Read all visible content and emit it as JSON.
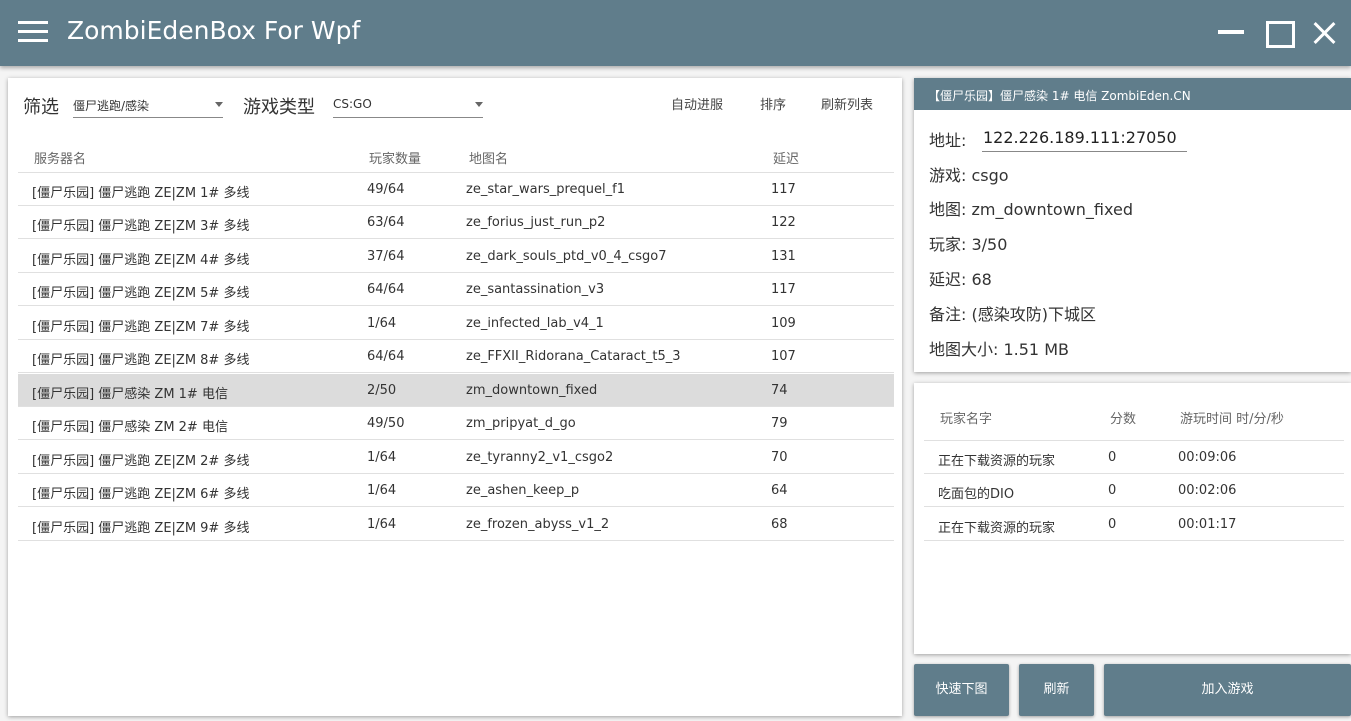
{
  "window": {
    "title": "ZombiEdenBox For Wpf"
  },
  "filters": {
    "filter_label": "筛选",
    "filter_value": "僵尸逃跑/感染",
    "game_type_label": "游戏类型",
    "game_type_value": "CS:GO",
    "auto_join_label": "自动进服",
    "sort_label": "排序",
    "refresh_list_label": "刷新列表"
  },
  "server_table": {
    "columns": [
      "服务器名",
      "玩家数量",
      "地图名",
      "延迟"
    ],
    "rows": [
      {
        "name": "[僵尸乐园] 僵尸逃跑 ZE|ZM 1# 多线",
        "players": "49/64",
        "map": "ze_star_wars_prequel_f1",
        "ping": "117"
      },
      {
        "name": "[僵尸乐园] 僵尸逃跑 ZE|ZM 3# 多线",
        "players": "63/64",
        "map": "ze_forius_just_run_p2",
        "ping": "122"
      },
      {
        "name": "[僵尸乐园] 僵尸逃跑 ZE|ZM 4# 多线",
        "players": "37/64",
        "map": "ze_dark_souls_ptd_v0_4_csgo7",
        "ping": "131"
      },
      {
        "name": "[僵尸乐园] 僵尸逃跑 ZE|ZM 5# 多线",
        "players": "64/64",
        "map": "ze_santassination_v3",
        "ping": "117"
      },
      {
        "name": "[僵尸乐园] 僵尸逃跑 ZE|ZM 7# 多线",
        "players": "1/64",
        "map": "ze_infected_lab_v4_1",
        "ping": "109"
      },
      {
        "name": "[僵尸乐园] 僵尸逃跑 ZE|ZM 8# 多线",
        "players": "64/64",
        "map": "ze_FFXII_Ridorana_Cataract_t5_3",
        "ping": "107"
      },
      {
        "name": "[僵尸乐园] 僵尸感染 ZM 1# 电信",
        "players": "2/50",
        "map": "zm_downtown_fixed",
        "ping": "74"
      },
      {
        "name": "[僵尸乐园] 僵尸感染 ZM 2# 电信",
        "players": "49/50",
        "map": "zm_pripyat_d_go",
        "ping": "79"
      },
      {
        "name": "[僵尸乐园] 僵尸逃跑 ZE|ZM 2# 多线",
        "players": "1/64",
        "map": "ze_tyranny2_v1_csgo2",
        "ping": "70"
      },
      {
        "name": "[僵尸乐园] 僵尸逃跑 ZE|ZM 6# 多线",
        "players": "1/64",
        "map": "ze_ashen_keep_p",
        "ping": "64"
      },
      {
        "name": "[僵尸乐园] 僵尸逃跑 ZE|ZM 9# 多线",
        "players": "1/64",
        "map": "ze_frozen_abyss_v1_2",
        "ping": "68"
      }
    ]
  },
  "server_info": {
    "header": "【僵尸乐园】僵尸感染 1# 电信 ZombiEden.CN",
    "address_label": "地址:",
    "address_value": "122.226.189.111:27050",
    "game_line": "游戏: csgo",
    "map_line": "地图: zm_downtown_fixed",
    "players_line": "玩家: 3/50",
    "ping_line": "延迟: 68",
    "note_line": "备注: (感染攻防)下城区",
    "map_size_line": "地图大小: 1.51 MB"
  },
  "players_table": {
    "columns": [
      "玩家名字",
      "分数",
      "游玩时间 时/分/秒"
    ],
    "rows": [
      {
        "name": "正在下载资源的玩家",
        "score": "0",
        "time": "00:09:06"
      },
      {
        "name": "吃面包的DIO",
        "score": "0",
        "time": "00:02:06"
      },
      {
        "name": "正在下载资源的玩家",
        "score": "0",
        "time": "00:01:17"
      }
    ]
  },
  "actions": {
    "quick_download": "快速下图",
    "refresh": "刷新",
    "join_game": "加入游戏"
  },
  "colors": {
    "primary": "#607d8b",
    "selected_row": "#dcdcdc"
  }
}
